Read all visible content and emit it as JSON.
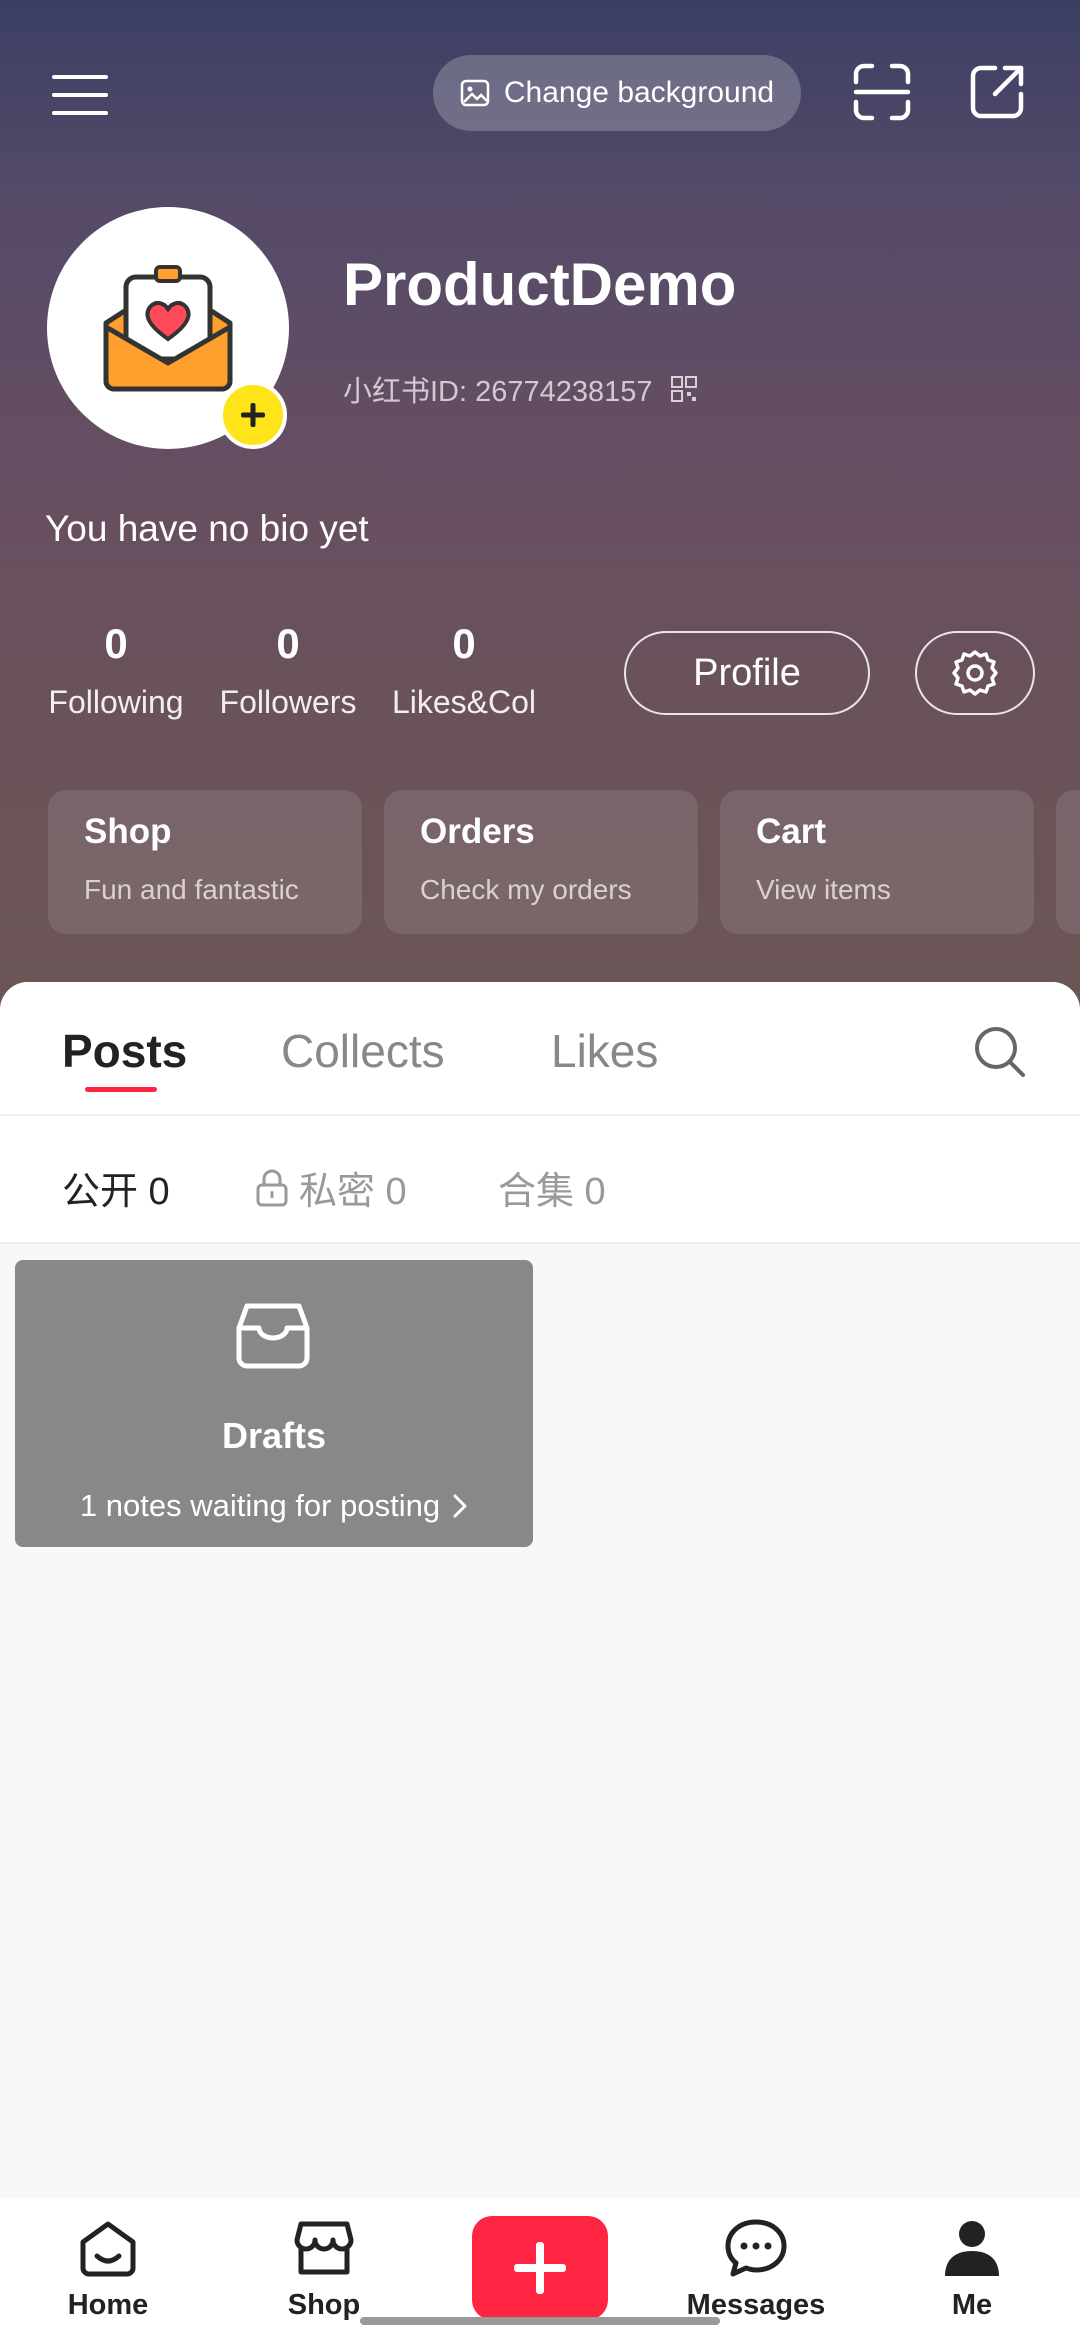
{
  "header": {
    "change_background_label": "Change background",
    "username": "ProductDemo",
    "user_id": "小红书ID: 26774238157",
    "bio": "You have no bio yet",
    "stats": [
      {
        "value": "0",
        "label": "Following"
      },
      {
        "value": "0",
        "label": "Followers"
      },
      {
        "value": "0",
        "label": "Likes&Col"
      }
    ],
    "profile_button": "Profile"
  },
  "cards": [
    {
      "title": "Shop",
      "subtitle": "Fun and fantastic"
    },
    {
      "title": "Orders",
      "subtitle": "Check my orders"
    },
    {
      "title": "Cart",
      "subtitle": "View items"
    }
  ],
  "tabs": [
    {
      "label": "Posts",
      "active": true
    },
    {
      "label": "Collects",
      "active": false
    },
    {
      "label": "Likes",
      "active": false
    }
  ],
  "subtabs": [
    {
      "label": "公开 0",
      "active": true
    },
    {
      "label": "私密 0",
      "active": false
    },
    {
      "label": "合集 0",
      "active": false
    }
  ],
  "drafts": {
    "title": "Drafts",
    "subtitle": "1 notes waiting for posting"
  },
  "bottom_nav": [
    {
      "label": "Home",
      "icon": "home-icon"
    },
    {
      "label": "Shop",
      "icon": "shop-icon"
    },
    {
      "label": "",
      "icon": "plus-icon"
    },
    {
      "label": "Messages",
      "icon": "messages-icon"
    },
    {
      "label": "Me",
      "icon": "me-icon"
    }
  ],
  "colors": {
    "accent": "#ff2442",
    "avatar_badge": "#ffe41a",
    "drafts_bg": "#888888"
  }
}
